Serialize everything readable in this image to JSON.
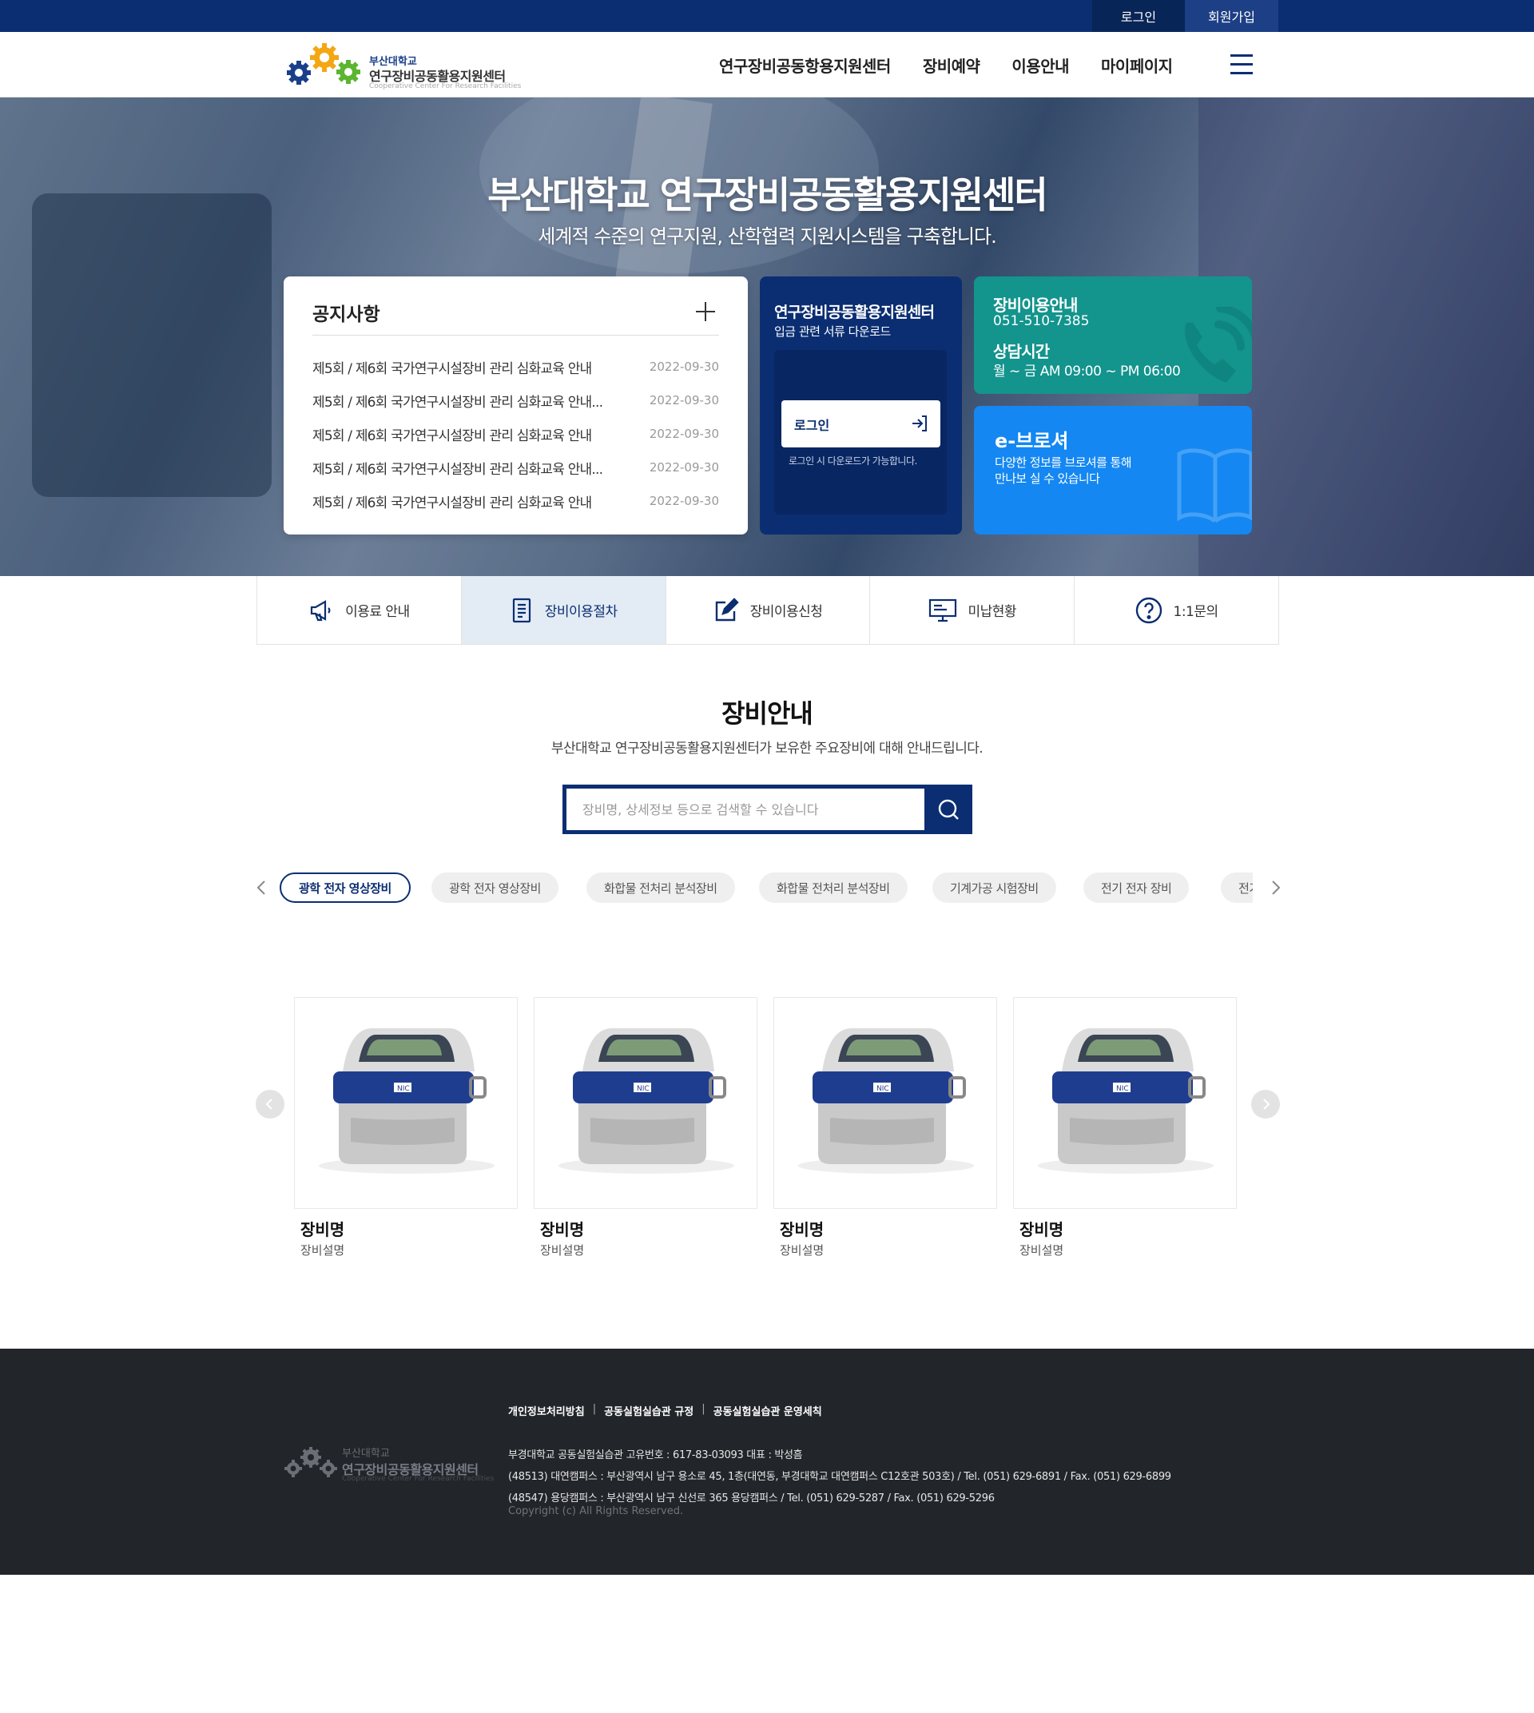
{
  "topbar": {
    "login": "로그인",
    "join": "회원가입"
  },
  "header": {
    "logo": {
      "univ": "부산대학교",
      "center": "연구장비공동활용지원센터",
      "english": "Cooperative Center For Research Facilities"
    },
    "nav": [
      "연구장비공동항용지원센터",
      "장비예약",
      "이용안내",
      "마이페이지"
    ],
    "menu_icon": "hamburger-icon"
  },
  "hero": {
    "title": "부산대학교 연구장비공동활용지원센터",
    "subtitle": "세계적 수준의 연구지원, 산학협력 지원시스템을 구축합니다."
  },
  "notice": {
    "title": "공지사항",
    "items": [
      {
        "title": "제5회 / 제6회 국가연구시설장비 관리 심화교육 안내",
        "date": "2022-09-30"
      },
      {
        "title": "제5회 / 제6회 국가연구시설장비 관리 심화교육 안내...",
        "date": "2022-09-30"
      },
      {
        "title": "제5회 / 제6회 국가연구시설장비 관리 심화교육 안내",
        "date": "2022-09-30"
      },
      {
        "title": "제5회 / 제6회 국가연구시설장비 관리 심화교육 안내...",
        "date": "2022-09-30"
      },
      {
        "title": "제5회 / 제6회 국가연구시설장비 관리 심화교육 안내",
        "date": "2022-09-30"
      }
    ]
  },
  "docs": {
    "title": "연구장비공동활용지원센터",
    "subtitle": "입금 관련 서류 다운로드",
    "login_button": "로그인",
    "note": "로그인 시 다운로드가 가능합니다."
  },
  "info": {
    "title": "장비이용안내",
    "phone": "051-510-7385",
    "hours_title": "상담시간",
    "hours": "월 ~ 금 AM 09:00 ~ PM 06:00"
  },
  "brochure": {
    "title": "e-브로셔",
    "line1": "다양한 정보를 브로셔를 통해",
    "line2": "만나보 실 수 있습니다"
  },
  "quick_menu": [
    {
      "label": "이용료 안내",
      "icon": "megaphone-icon"
    },
    {
      "label": "장비이용절차",
      "icon": "document-icon"
    },
    {
      "label": "장비이용신청",
      "icon": "edit-icon"
    },
    {
      "label": "미납현황",
      "icon": "monitor-icon"
    },
    {
      "label": "1:1문의",
      "icon": "question-icon"
    }
  ],
  "equipment": {
    "title": "장비안내",
    "subtitle": "부산대학교 연구장비공동활용지원센터가 보유한 주요장비에 대해 안내드립니다.",
    "search_placeholder": "장비명, 상세정보 등으로 검색할 수 있습니다",
    "categories": [
      "광학 전자 영상장비",
      "광학 전자 영상장비",
      "화합물 전처리 분석장비",
      "화합물 전처리 분석장비",
      "기계가공 시험장비",
      "전기 전자 장비",
      "전기 전자 장비"
    ],
    "cards": [
      {
        "name": "장비명",
        "desc": "장비설명",
        "badge": "NIC"
      },
      {
        "name": "장비명",
        "desc": "장비설명",
        "badge": "NIC"
      },
      {
        "name": "장비명",
        "desc": "장비설명",
        "badge": "NIC"
      },
      {
        "name": "장비명",
        "desc": "장비설명",
        "badge": "NIC"
      }
    ]
  },
  "footer": {
    "logo": {
      "univ": "부산대학교",
      "center": "연구장비공동활용지원센터",
      "english": "Cooperative Center For Research Facilities"
    },
    "links": [
      "개인정보처리방침",
      "공동실험실습관 규정",
      "공동실험실습관 운영세칙"
    ],
    "lines": [
      "부경대학교 공동실험실습관 고유번호 : 617-83-03093 대표 : 박성흠",
      "(48513) 대연캠퍼스 : 부산광역시 남구 용소로 45, 1층(대연동, 부경대학교 대연캠퍼스 C12호관 503호) / Tel. (051) 629-6891 / Fax. (051) 629-6899",
      "(48547) 용당캠퍼스 : 부산광역시 남구 신선로 365 용당캠퍼스 / Tel. (051) 629-5287 / Fax. (051) 629-5296"
    ],
    "copyright": "Copyright (c) All Rights Reserved."
  }
}
